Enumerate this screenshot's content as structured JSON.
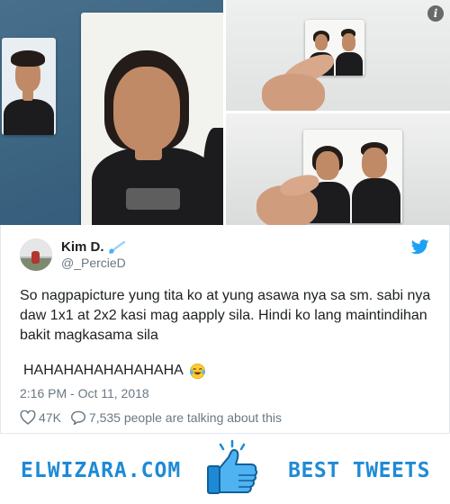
{
  "tweet": {
    "display_name": "Kim D.",
    "handle": "@_PercieD",
    "text": "So nagpapicture yung tita ko at yung asawa nya sa sm. sabi nya daw 1x1 at 2x2 kasi mag aapply sila. Hindi ko lang maintindihan bakit magkasama sila",
    "laugh_line": "HAHAHAHAHAHAHAHA",
    "timestamp": "2:16 PM - Oct 11, 2018",
    "likes": "47K",
    "talking": "7,535 people are talking about this"
  },
  "banner": {
    "left_text": "ELWIZARA.COM",
    "right_text": "BEST TWEETS"
  },
  "icons": {
    "info": "info-icon",
    "bird": "twitter-bird-icon",
    "heart": "heart-icon",
    "comment": "comment-icon",
    "thumb": "thumbs-up-icon",
    "emoji": "tears-of-joy-emoji"
  },
  "colors": {
    "twitter_blue": "#1da1f2",
    "banner_blue": "#1e8ad6",
    "muted_text": "#697882"
  }
}
